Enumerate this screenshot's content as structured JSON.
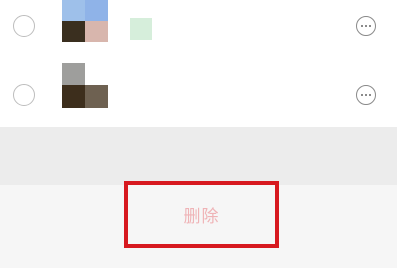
{
  "list": {
    "items": [
      {
        "selected": false,
        "thumbnail_colors": [
          "#9ec0ea",
          "#8fb3e8",
          "#3a2f1f",
          "#d8b6ad"
        ],
        "tag_color": "#d6eedb",
        "more_icon": "more-horizontal-icon"
      },
      {
        "selected": false,
        "thumbnail_colors": [
          "#9e9e9c",
          "#ffffff",
          "#3d2e1c",
          "#6e6151"
        ],
        "more_icon": "more-horizontal-icon"
      }
    ]
  },
  "actions": {
    "delete_label": "删除",
    "delete_label_color": "#efb3b6",
    "highlight_color": "#d7191f"
  }
}
